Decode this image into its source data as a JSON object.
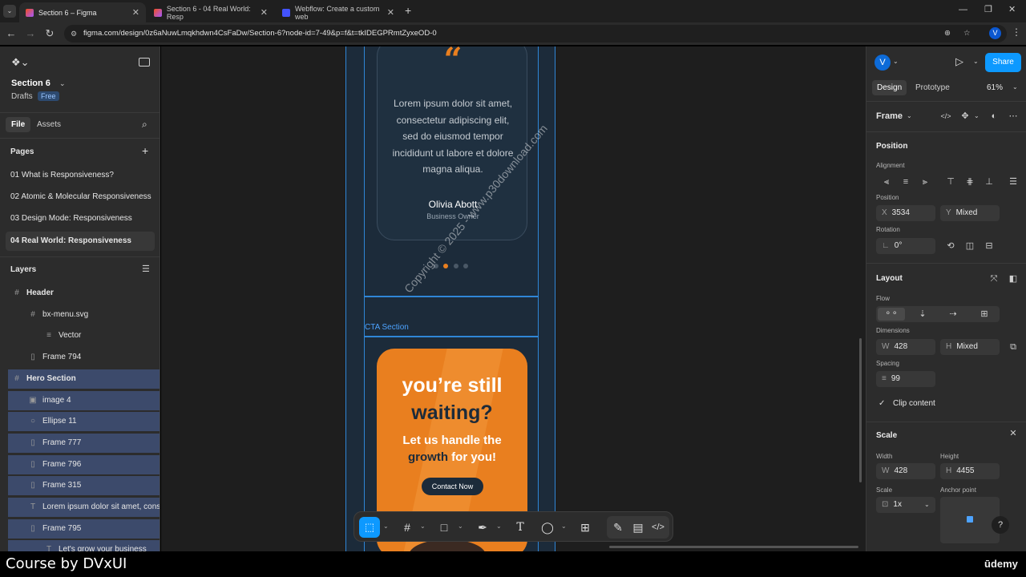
{
  "browser": {
    "tabs": [
      {
        "title": "Section 6 – Figma",
        "active": true
      },
      {
        "title": "Section 6 - 04 Real World: Resp",
        "active": false
      },
      {
        "title": "Webflow: Create a custom web",
        "active": false
      }
    ],
    "new_tab": "+",
    "url": "figma.com/design/0z6aNuwLmqkhdwn4CsFaDw/Section-6?node-id=7-49&p=f&t=tkIDEGPRmtZyxeOD-0",
    "profile_initial": "V"
  },
  "left_panel": {
    "file_name": "Section 6",
    "drafts_label": "Drafts",
    "plan_badge": "Free",
    "tabs": {
      "file": "File",
      "assets": "Assets"
    },
    "pages_title": "Pages",
    "pages": [
      "01 What is Responsiveness?",
      "02 Atomic & Molecular Responsiveness",
      "03 Design Mode: Responsiveness",
      "04 Real World: Responsiveness"
    ],
    "layers_title": "Layers",
    "layers": [
      {
        "name": "Header",
        "icon": "frame-icon",
        "indent": 0,
        "selected": false
      },
      {
        "name": "bx-menu.svg",
        "icon": "frame-icon",
        "indent": 1,
        "selected": false
      },
      {
        "name": "Vector",
        "icon": "vector-icon",
        "indent": 2,
        "selected": false
      },
      {
        "name": "Frame 794",
        "icon": "autolayout-icon",
        "indent": 1,
        "selected": false
      },
      {
        "name": "Hero Section",
        "icon": "frame-icon",
        "indent": 0,
        "selected": true
      },
      {
        "name": "image 4",
        "icon": "image-icon",
        "indent": 1,
        "selected": true
      },
      {
        "name": "Ellipse 11",
        "icon": "ellipse-icon",
        "indent": 1,
        "selected": true
      },
      {
        "name": "Frame 777",
        "icon": "autolayout-icon",
        "indent": 1,
        "selected": true
      },
      {
        "name": "Frame 796",
        "icon": "autolayout-icon",
        "indent": 1,
        "selected": true
      },
      {
        "name": "Frame 315",
        "icon": "autolayout-icon",
        "indent": 1,
        "selected": true
      },
      {
        "name": "Lorem ipsum dolor sit amet, conse",
        "icon": "text-icon",
        "indent": 1,
        "selected": true
      },
      {
        "name": "Frame 795",
        "icon": "autolayout-icon",
        "indent": 1,
        "selected": true
      },
      {
        "name": "Let's grow your business",
        "icon": "text-icon",
        "indent": 2,
        "selected": true
      }
    ]
  },
  "canvas": {
    "testimonial": {
      "quote_mark": "“",
      "text_lines": [
        "Lorem ipsum dolor sit amet,",
        "consectetur adipiscing elit,",
        "sed do eiusmod tempor",
        "incididunt ut labore et dolore",
        "magna aliqua."
      ],
      "name": "Olivia Abott",
      "role": "Business Owner"
    },
    "section_label": "CTA Section",
    "cta": {
      "headline_1": "you’re still",
      "headline_2": "waiting?",
      "sub_1": "Let us handle the",
      "sub_2a": "growth",
      "sub_2b": " for you!",
      "button": "Contact Now"
    },
    "watermark": "Copyright © 2025 - www.p30download.com",
    "colors": {
      "frame_bg": "#1c2b3a",
      "card_bg": "#1f3040",
      "cta_orange": "#e97f1f",
      "dot_active": "#e97f1f",
      "selection_blue": "#2f86d6"
    }
  },
  "right_panel": {
    "avatar_initial": "V",
    "share_label": "Share",
    "tabs": {
      "design": "Design",
      "prototype": "Prototype"
    },
    "zoom": "61%",
    "frame_label": "Frame",
    "position_title": "Position",
    "alignment_label": "Alignment",
    "position_label": "Position",
    "x_prefix": "X",
    "x_value": "3534",
    "y_prefix": "Y",
    "y_value": "Mixed",
    "rotation_label": "Rotation",
    "rotation_value": "0°",
    "layout_title": "Layout",
    "flow_label": "Flow",
    "dimensions_label": "Dimensions",
    "w_prefix": "W",
    "w_value": "428",
    "h_prefix": "H",
    "h_value": "Mixed",
    "spacing_label": "Spacing",
    "spacing_value": "99",
    "clip_label": "Clip content",
    "scale_title": "Scale",
    "width_label": "Width",
    "width_value": "428",
    "height_label": "Height",
    "height_value": "4455",
    "scale_label": "Scale",
    "scale_value": "1x",
    "anchor_label": "Anchor point",
    "help": "?"
  },
  "footer": {
    "course_text": "Course by DVxUI",
    "brand": "ūdemy"
  }
}
